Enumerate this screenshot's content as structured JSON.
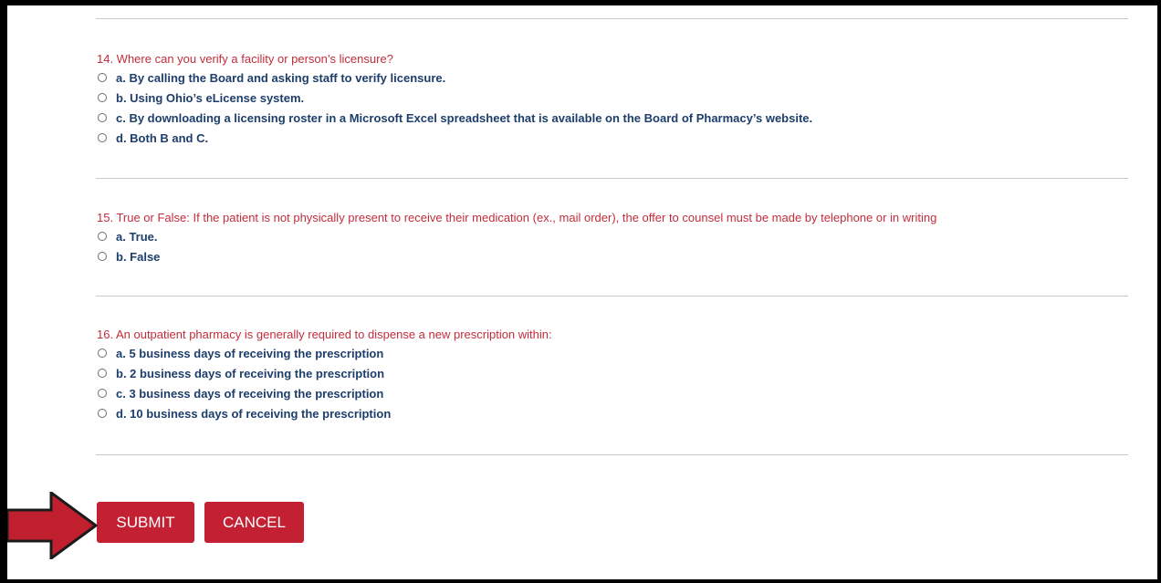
{
  "questions": [
    {
      "text": "14. Where can you verify a facility or person’s licensure?",
      "options": [
        "a. By calling the Board and asking staff to verify licensure.",
        "b. Using Ohio’s eLicense system.",
        "c. By downloading a licensing roster in a Microsoft Excel spreadsheet that is available on the Board of Pharmacy’s website.",
        "d. Both B and C."
      ]
    },
    {
      "text": "15. True or False: If the patient is not physically present to receive their medication (ex., mail order), the offer to counsel must be made by telephone or in writing",
      "options": [
        "a. True.",
        "b. False"
      ]
    },
    {
      "text": "16. An outpatient pharmacy is generally required to dispense a new prescription within:",
      "options": [
        "a. 5 business days of receiving the prescription",
        "b. 2 business days of receiving the prescription",
        "c. 3 business days of receiving the prescription",
        "d. 10 business days of receiving the prescription"
      ]
    }
  ],
  "buttons": {
    "submit": "SUBMIT",
    "cancel": "CANCEL"
  },
  "colors": {
    "question_text": "#c32d3b",
    "option_text": "#1d3e6b",
    "button_bg": "#c42033",
    "arrow_fill": "#c0202e",
    "divider": "#c8c8c8",
    "page_border": "#000000"
  },
  "icons": {
    "pointer": "red-right-arrow-icon",
    "radio": "radio-button-icon"
  }
}
